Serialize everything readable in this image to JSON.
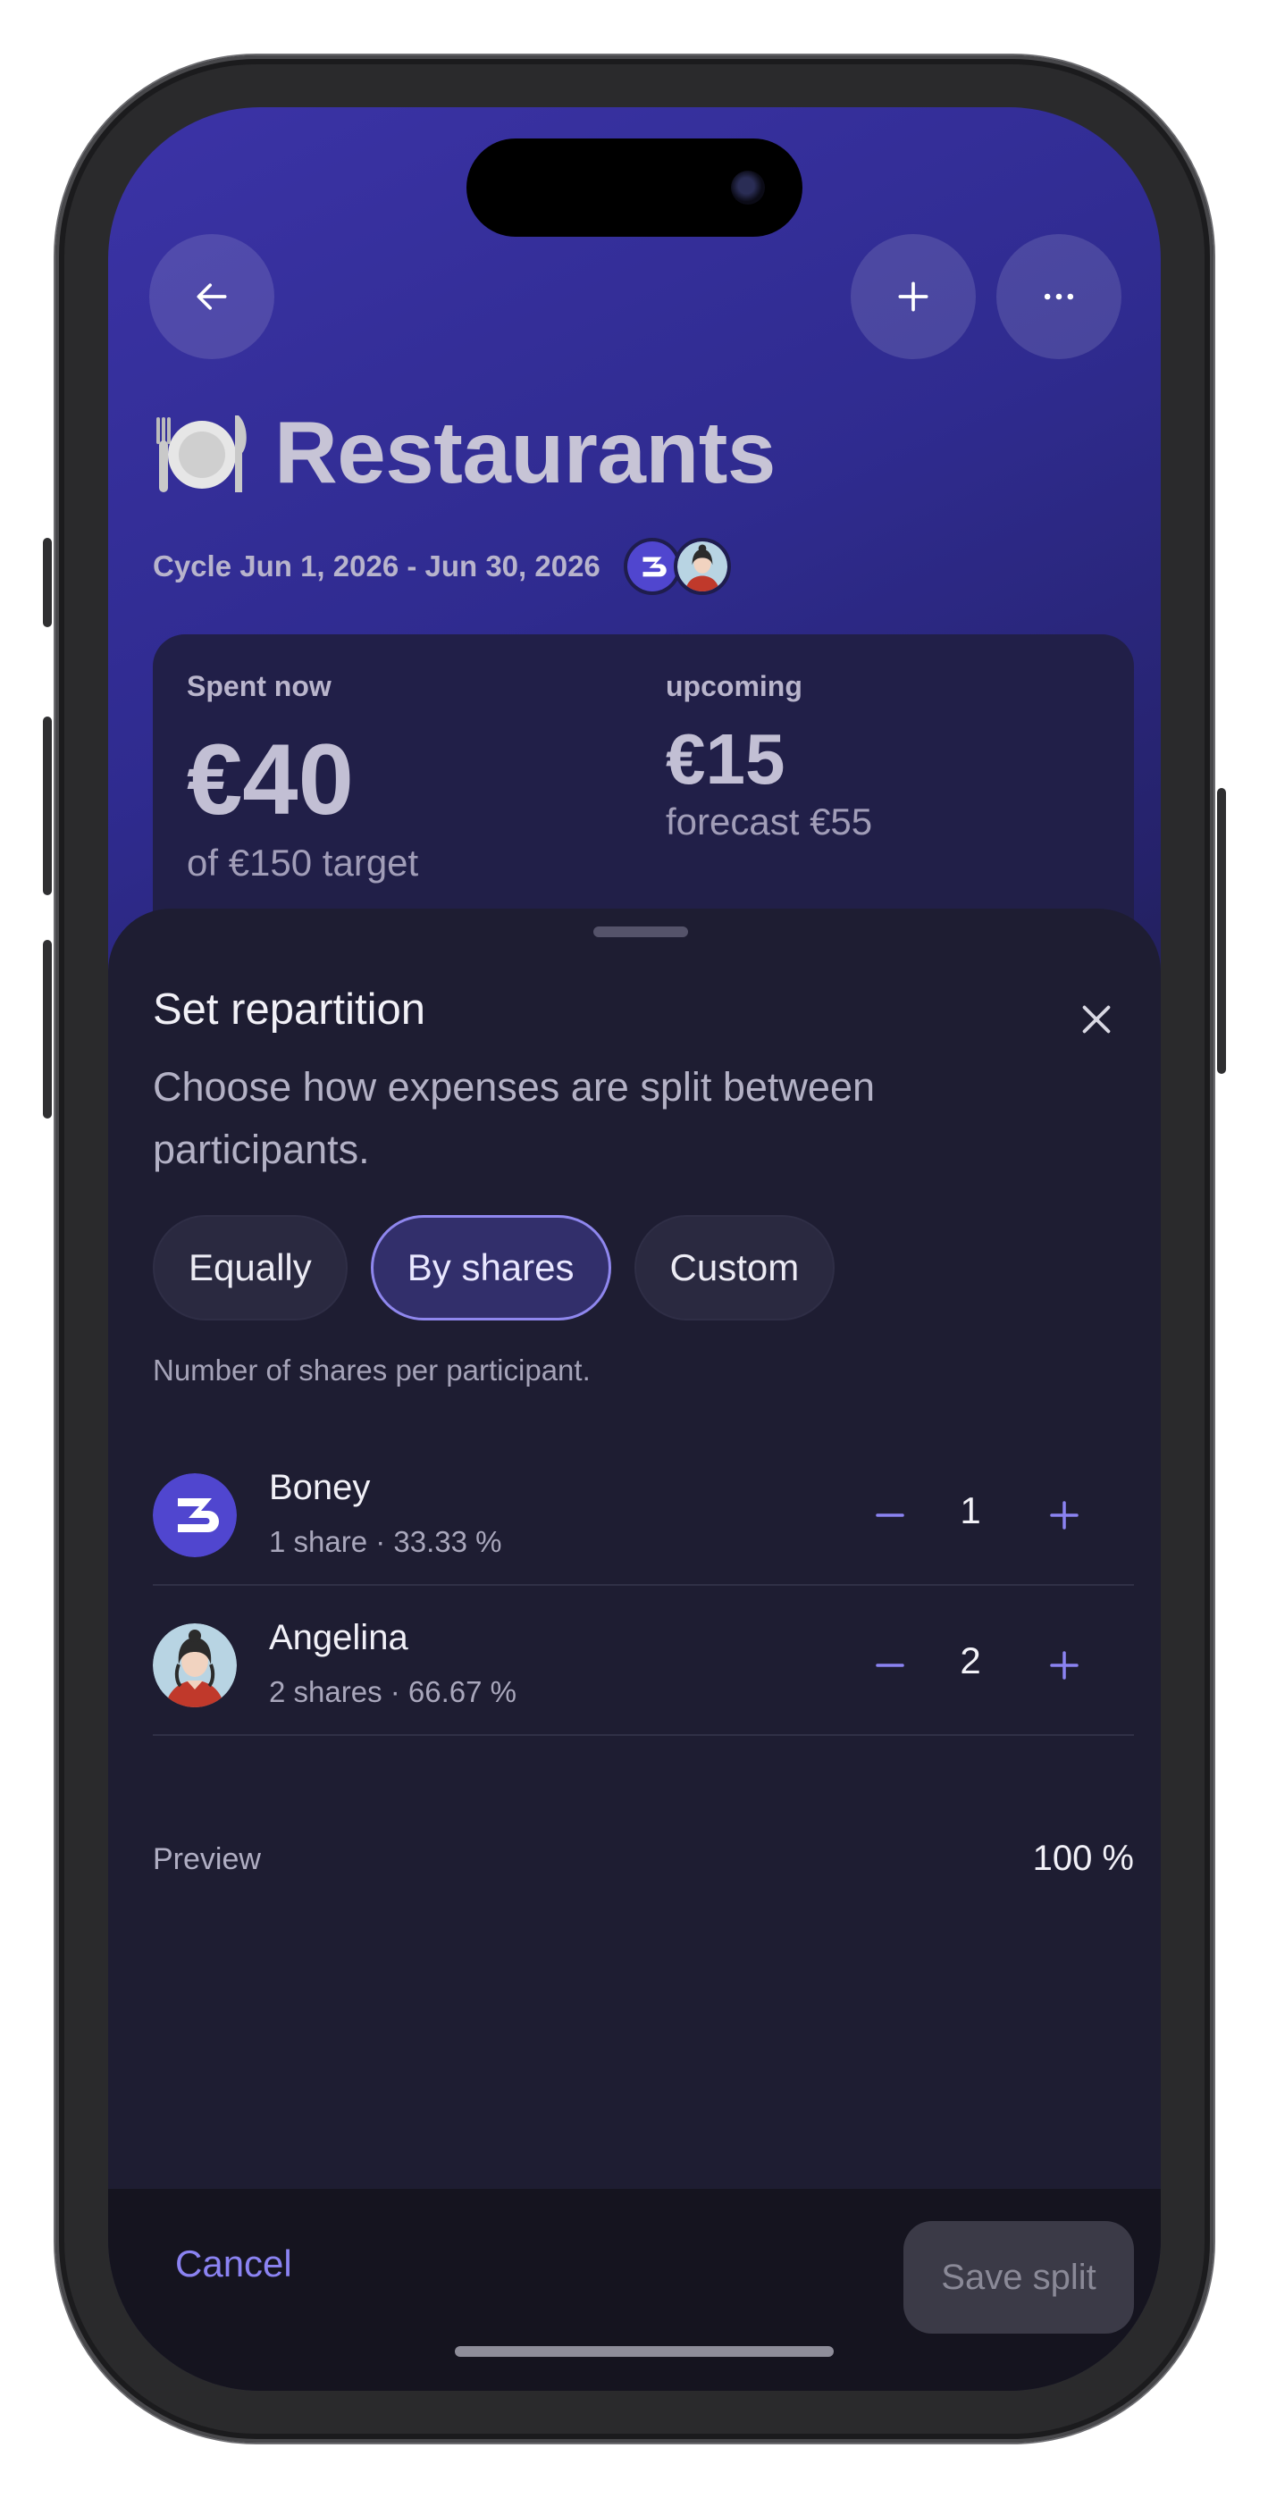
{
  "header": {
    "back_icon": "arrow-left-icon",
    "add_icon": "plus-icon",
    "more_icon": "more-horizontal-icon",
    "emoji": "fork-knife-plate",
    "title": "Restaurants",
    "cycle": "Cycle Jun 1, 2026 - Jun 30, 2026"
  },
  "summary": {
    "spent_label": "Spent now",
    "spent_value": "€40",
    "target_text": "of €150 target",
    "upcoming_label": "upcoming",
    "upcoming_value": "€15",
    "forecast_text": "forecast €55"
  },
  "sheet": {
    "title": "Set repartition",
    "description": "Choose how expenses are split between participants.",
    "modes": [
      "Equally",
      "By shares",
      "Custom"
    ],
    "selected_mode": "By shares",
    "hint": "Number of shares per participant.",
    "participants": [
      {
        "name": "Boney",
        "meta": "1 share · 33.33 %",
        "shares": "1",
        "avatar": "boney-logo"
      },
      {
        "name": "Angelina",
        "meta": "2 shares · 66.67 %",
        "shares": "2",
        "avatar": "angelina-portrait"
      }
    ],
    "preview_label": "Preview",
    "preview_value": "100 %"
  },
  "footer": {
    "cancel_label": "Cancel",
    "save_label": "Save split"
  },
  "colors": {
    "accent": "#8b83f2",
    "sheet_bg": "#1e1d32",
    "header_gradient_start": "#3b33a6",
    "active_segment_border": "#8f87ee",
    "boney_avatar_bg": "#5046cf"
  }
}
